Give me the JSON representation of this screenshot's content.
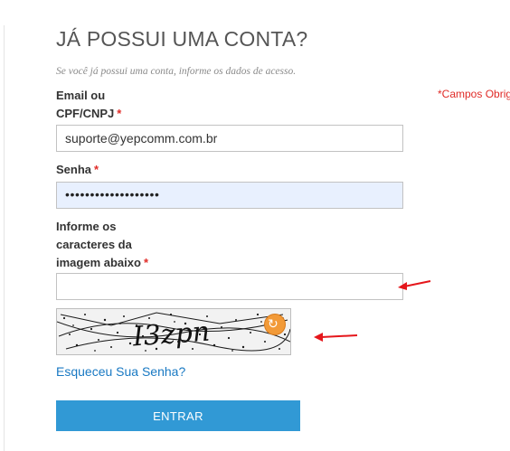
{
  "form": {
    "title": "JÁ POSSUI UMA CONTA?",
    "subtitle": "Se você já possui uma conta, informe os dados de acesso.",
    "required_note": "*Campos Obrig",
    "email": {
      "label_line1": "Email ou",
      "label_line2": "CPF/CNPJ",
      "required_mark": "*",
      "value": "suporte@yepcomm.com.br"
    },
    "password": {
      "label": "Senha",
      "required_mark": "*",
      "masked_value": "•••••••••••••••••••"
    },
    "captcha": {
      "label_line1": "Informe os",
      "label_line2": "caracteres da",
      "label_line3": "imagem abaixo",
      "required_mark": "*",
      "value": "",
      "image_text": "I3zpn",
      "reload_icon": "refresh-icon"
    },
    "forgot_password_link": "Esqueceu Sua Senha?",
    "submit_label": "ENTRAR"
  },
  "annotations": {
    "arrow_color": "#e5161b"
  },
  "colors": {
    "accent": "#3199d5",
    "link": "#1979c3",
    "required": "#e02b27",
    "autofill_bg": "#e8f0fe"
  }
}
